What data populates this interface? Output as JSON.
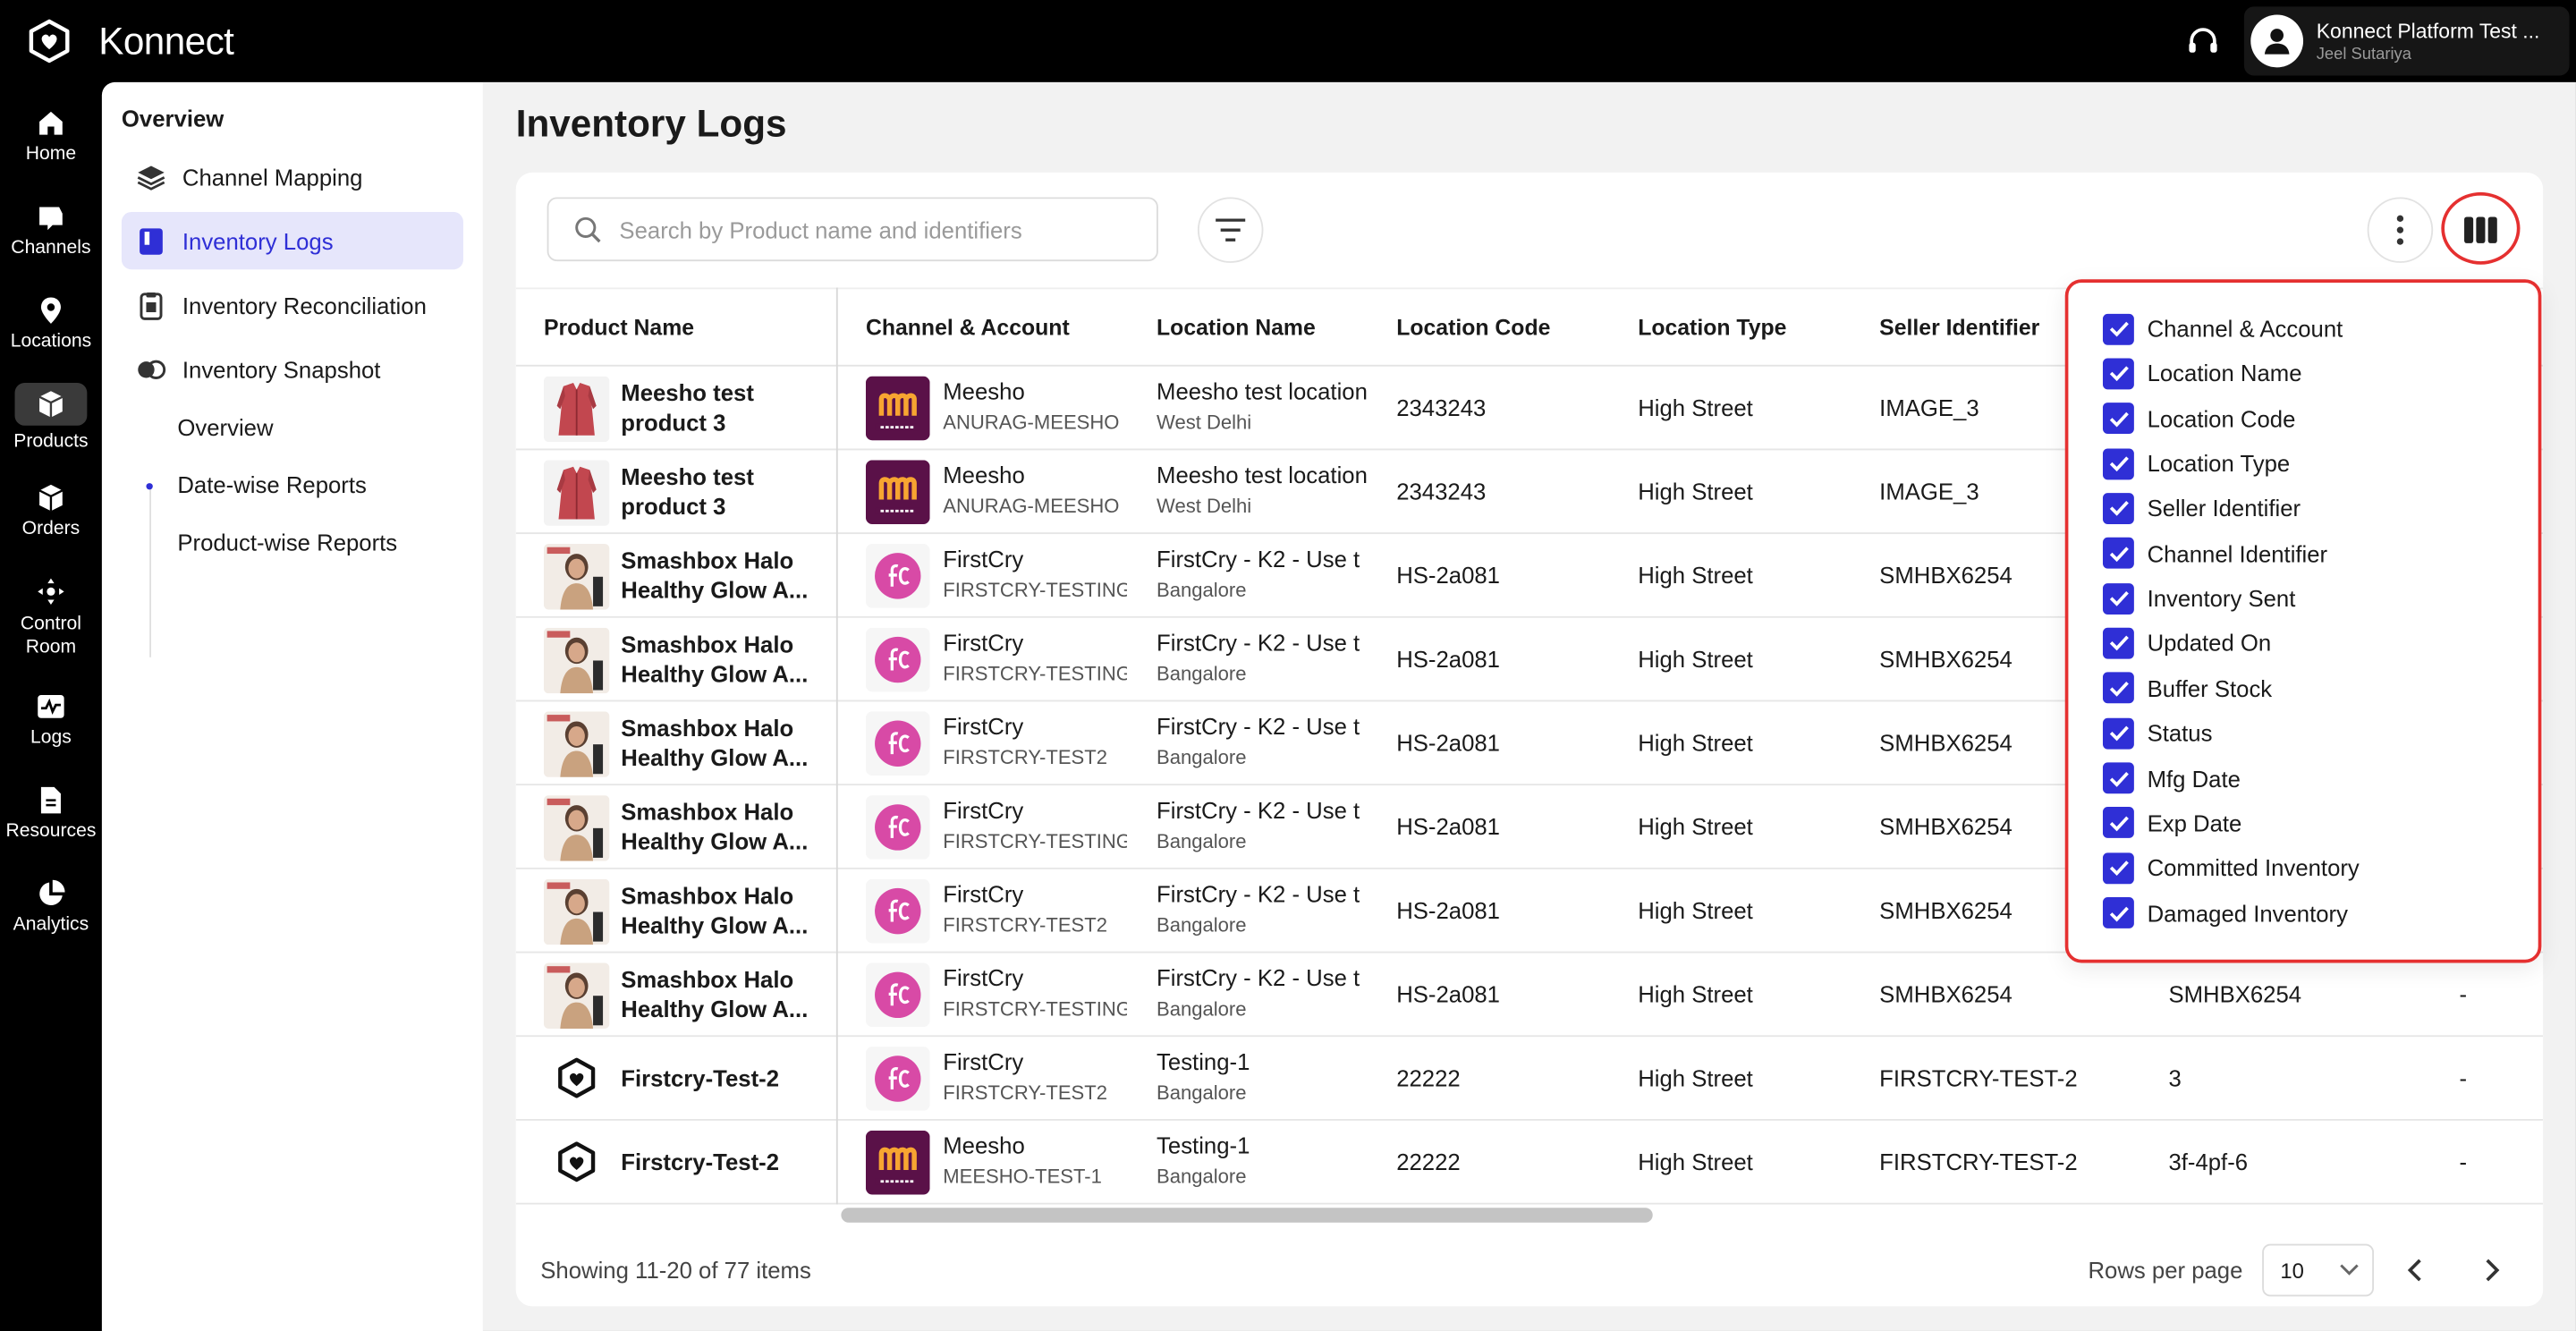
{
  "app": {
    "brand": "Konnect",
    "user_name": "Konnect Platform Test ...",
    "user_sub": "Jeel Sutariya"
  },
  "rail": [
    {
      "label": "Home",
      "icon": "home-icon"
    },
    {
      "label": "Channels",
      "icon": "channels-icon"
    },
    {
      "label": "Locations",
      "icon": "location-pin-icon"
    },
    {
      "label": "Products",
      "icon": "products-box-icon"
    },
    {
      "label": "Orders",
      "icon": "orders-cube-icon"
    },
    {
      "label": "Control Room",
      "icon": "control-room-icon"
    },
    {
      "label": "Logs",
      "icon": "logs-icon"
    },
    {
      "label": "Resources",
      "icon": "document-icon"
    },
    {
      "label": "Analytics",
      "icon": "pie-chart-icon"
    }
  ],
  "sidenav": {
    "heading": "Overview",
    "items": [
      {
        "label": "Channel Mapping",
        "icon": "layers-icon"
      },
      {
        "label": "Inventory Logs",
        "icon": "book-icon"
      },
      {
        "label": "Inventory Reconciliation",
        "icon": "clipboard-icon"
      },
      {
        "label": "Inventory Snapshot",
        "icon": "toggle-icon"
      }
    ],
    "sub_items": [
      "Overview",
      "Date-wise Reports",
      "Product-wise Reports"
    ]
  },
  "page": {
    "title": "Inventory Logs",
    "search_placeholder": "Search by Product name and identifiers"
  },
  "table": {
    "headers": [
      "Product Name",
      "Channel & Account",
      "Location Name",
      "Location Code",
      "Location Type",
      "Seller Identifier"
    ],
    "rows": [
      {
        "product": "Meesho test product 3",
        "thumb": "jacket",
        "channel": "Meesho",
        "account": "ANURAG-MEESHO",
        "location": "Meesho test location",
        "city": "West Delhi",
        "code": "2343243",
        "type": "High Street",
        "seller": "IMAGE_3",
        "channel_id": "",
        "last": ""
      },
      {
        "product": "Meesho test product 3",
        "thumb": "jacket",
        "channel": "Meesho",
        "account": "ANURAG-MEESHO",
        "location": "Meesho test location",
        "city": "West Delhi",
        "code": "2343243",
        "type": "High Street",
        "seller": "IMAGE_3",
        "channel_id": "",
        "last": ""
      },
      {
        "product": "Smashbox Halo Healthy Glow A...",
        "thumb": "cosmetic",
        "channel": "FirstCry",
        "account": "FIRSTCRY-TESTING",
        "location": "FirstCry - K2 - Use t",
        "city": "Bangalore",
        "code": "HS-2a081",
        "type": "High Street",
        "seller": "SMHBX6254",
        "channel_id": "",
        "last": ""
      },
      {
        "product": "Smashbox Halo Healthy Glow A...",
        "thumb": "cosmetic",
        "channel": "FirstCry",
        "account": "FIRSTCRY-TESTING",
        "location": "FirstCry - K2 - Use t",
        "city": "Bangalore",
        "code": "HS-2a081",
        "type": "High Street",
        "seller": "SMHBX6254",
        "channel_id": "",
        "last": ""
      },
      {
        "product": "Smashbox Halo Healthy Glow A...",
        "thumb": "cosmetic",
        "channel": "FirstCry",
        "account": "FIRSTCRY-TEST2",
        "location": "FirstCry - K2 - Use t",
        "city": "Bangalore",
        "code": "HS-2a081",
        "type": "High Street",
        "seller": "SMHBX6254",
        "channel_id": "",
        "last": ""
      },
      {
        "product": "Smashbox Halo Healthy Glow A...",
        "thumb": "cosmetic",
        "channel": "FirstCry",
        "account": "FIRSTCRY-TESTING",
        "location": "FirstCry - K2 - Use t",
        "city": "Bangalore",
        "code": "HS-2a081",
        "type": "High Street",
        "seller": "SMHBX6254",
        "channel_id": "",
        "last": ""
      },
      {
        "product": "Smashbox Halo Healthy Glow A...",
        "thumb": "cosmetic",
        "channel": "FirstCry",
        "account": "FIRSTCRY-TEST2",
        "location": "FirstCry - K2 - Use t",
        "city": "Bangalore",
        "code": "HS-2a081",
        "type": "High Street",
        "seller": "SMHBX6254",
        "channel_id": "",
        "last": ""
      },
      {
        "product": "Smashbox Halo Healthy Glow A...",
        "thumb": "cosmetic",
        "channel": "FirstCry",
        "account": "FIRSTCRY-TESTING",
        "location": "FirstCry - K2 - Use t",
        "city": "Bangalore",
        "code": "HS-2a081",
        "type": "High Street",
        "seller": "SMHBX6254",
        "channel_id": "SMHBX6254",
        "last": "-"
      },
      {
        "product": "Firstcry-Test-2",
        "thumb": "konnect",
        "channel": "FirstCry",
        "account": "FIRSTCRY-TEST2",
        "location": "Testing-1",
        "city": "Bangalore",
        "code": "22222",
        "type": "High Street",
        "seller": "FIRSTCRY-TEST-2",
        "channel_id": "3",
        "last": "-"
      },
      {
        "product": "Firstcry-Test-2",
        "thumb": "konnect",
        "channel": "Meesho",
        "account": "MEESHO-TEST-1",
        "location": "Testing-1",
        "city": "Bangalore",
        "code": "22222",
        "type": "High Street",
        "seller": "FIRSTCRY-TEST-2",
        "channel_id": "3f-4pf-6",
        "last": "-"
      }
    ]
  },
  "footer": {
    "showing": "Showing 11-20 of 77 items",
    "rows_per_page_label": "Rows per page",
    "rows_per_page_value": "10"
  },
  "columns_panel": {
    "options": [
      "Channel & Account",
      "Location Name",
      "Location Code",
      "Location Type",
      "Seller Identifier",
      "Channel Identifier",
      "Inventory Sent",
      "Updated On",
      "Buffer Stock",
      "Status",
      "Mfg Date",
      "Exp Date",
      "Committed Inventory",
      "Damaged Inventory"
    ]
  },
  "colors": {
    "accent": "#2f2fd6",
    "highlight_ring": "#e53030",
    "meesho": "#5a1148",
    "firstcry": "#d84aa6"
  }
}
